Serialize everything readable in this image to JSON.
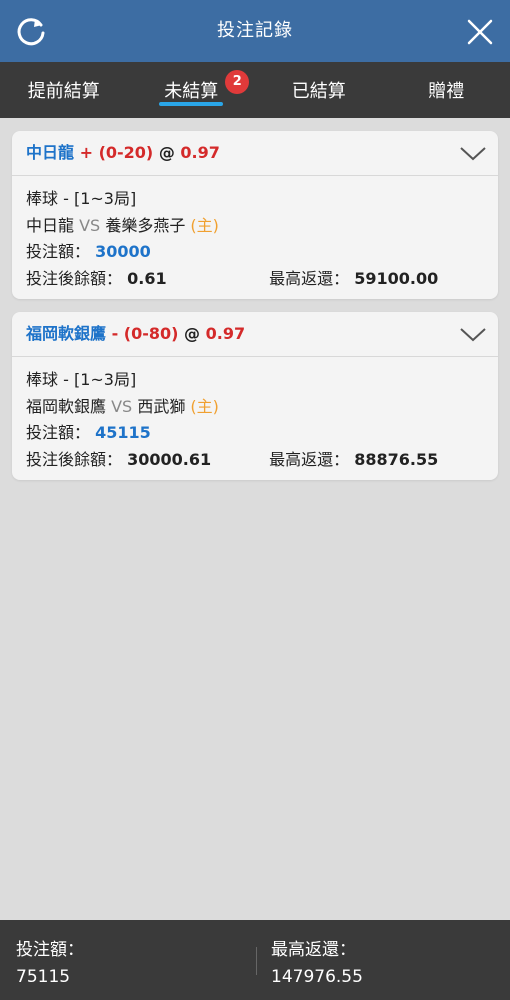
{
  "header": {
    "title": "投注記錄",
    "refresh_icon": "refresh-icon",
    "close_icon": "close-icon"
  },
  "tabs": [
    {
      "label": "提前結算",
      "active": false
    },
    {
      "label": "未結算",
      "active": true,
      "badge": "2"
    },
    {
      "label": "已結算",
      "active": false
    },
    {
      "label": "贈禮",
      "active": false
    }
  ],
  "bets": [
    {
      "team": "中日龍",
      "handicap": "+ (0-20)",
      "at": "@",
      "odds": "0.97",
      "sport": "棒球 - [1~3局]",
      "home_team": "中日龍",
      "vs": "VS",
      "away_team": "養樂多燕子",
      "home_marker": "(主)",
      "stake_label": "投注額：",
      "stake": "30000",
      "balance_label": "投注後餘額：",
      "balance": "0.61",
      "max_return_label": "最高返還：",
      "max_return": "59100.00"
    },
    {
      "team": "福岡軟銀鷹",
      "handicap": "- (0-80)",
      "at": "@",
      "odds": "0.97",
      "sport": "棒球 - [1~3局]",
      "home_team": "福岡軟銀鷹",
      "vs": "VS",
      "away_team": "西武獅",
      "home_marker": "(主)",
      "stake_label": "投注額：",
      "stake": "45115",
      "balance_label": "投注後餘額：",
      "balance": "30000.61",
      "max_return_label": "最高返還：",
      "max_return": "88876.55"
    }
  ],
  "footer": {
    "stake_label": "投注額：",
    "stake_total": "75115",
    "max_return_label": "最高返還：",
    "max_return_total": "147976.55"
  },
  "colors": {
    "header": "#3d6da3",
    "tabbar": "#3a3a3a",
    "accent": "#2aa6e8",
    "badge": "#e03a3a",
    "team": "#1e73c9",
    "odds": "#d42a2a",
    "home": "#f0a030"
  }
}
